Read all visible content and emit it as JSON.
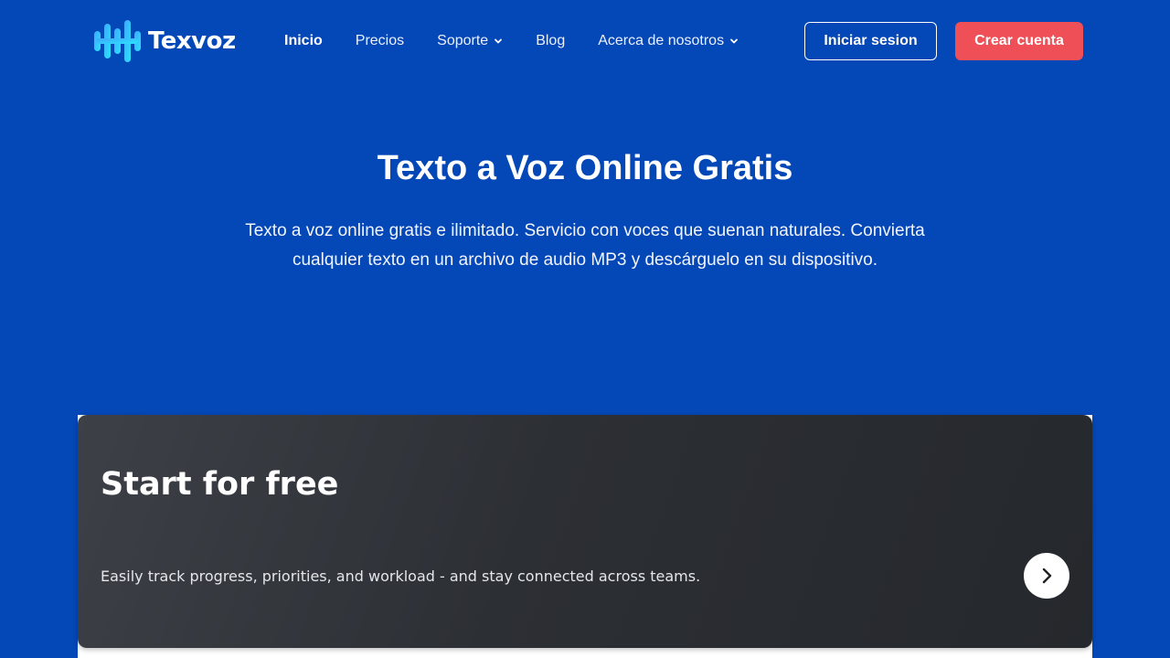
{
  "brand": {
    "name": "Texvoz",
    "logo_icon": "soundwave-logo-icon"
  },
  "nav": {
    "items": [
      {
        "label": "Inicio",
        "active": true,
        "has_dropdown": false
      },
      {
        "label": "Precios",
        "active": false,
        "has_dropdown": false
      },
      {
        "label": "Soporte",
        "active": false,
        "has_dropdown": true
      },
      {
        "label": "Blog",
        "active": false,
        "has_dropdown": false
      },
      {
        "label": "Acerca de nosotros",
        "active": false,
        "has_dropdown": true
      }
    ],
    "dropdown_icon": "chevron-down-icon"
  },
  "auth": {
    "login_label": "Iniciar sesion",
    "signup_label": "Crear cuenta"
  },
  "hero": {
    "title": "Texto a Voz Online Gratis",
    "subtitle": "Texto a voz online gratis e ilimitado. Servicio con voces que suenan naturales. Convierta cualquier texto en un archivo de audio MP3 y descárguelo en su dispositivo."
  },
  "promo": {
    "title": "Start for free",
    "description": "Easily track progress, priorities, and workload - and stay connected across teams.",
    "arrow_icon": "chevron-right-icon"
  },
  "colors": {
    "background": "#0447b7",
    "signup_button": "#ef4f57",
    "card_dark": "#2c2f34",
    "logo_gradient_start": "#3fa7ff",
    "logo_gradient_end": "#2be3ff"
  }
}
